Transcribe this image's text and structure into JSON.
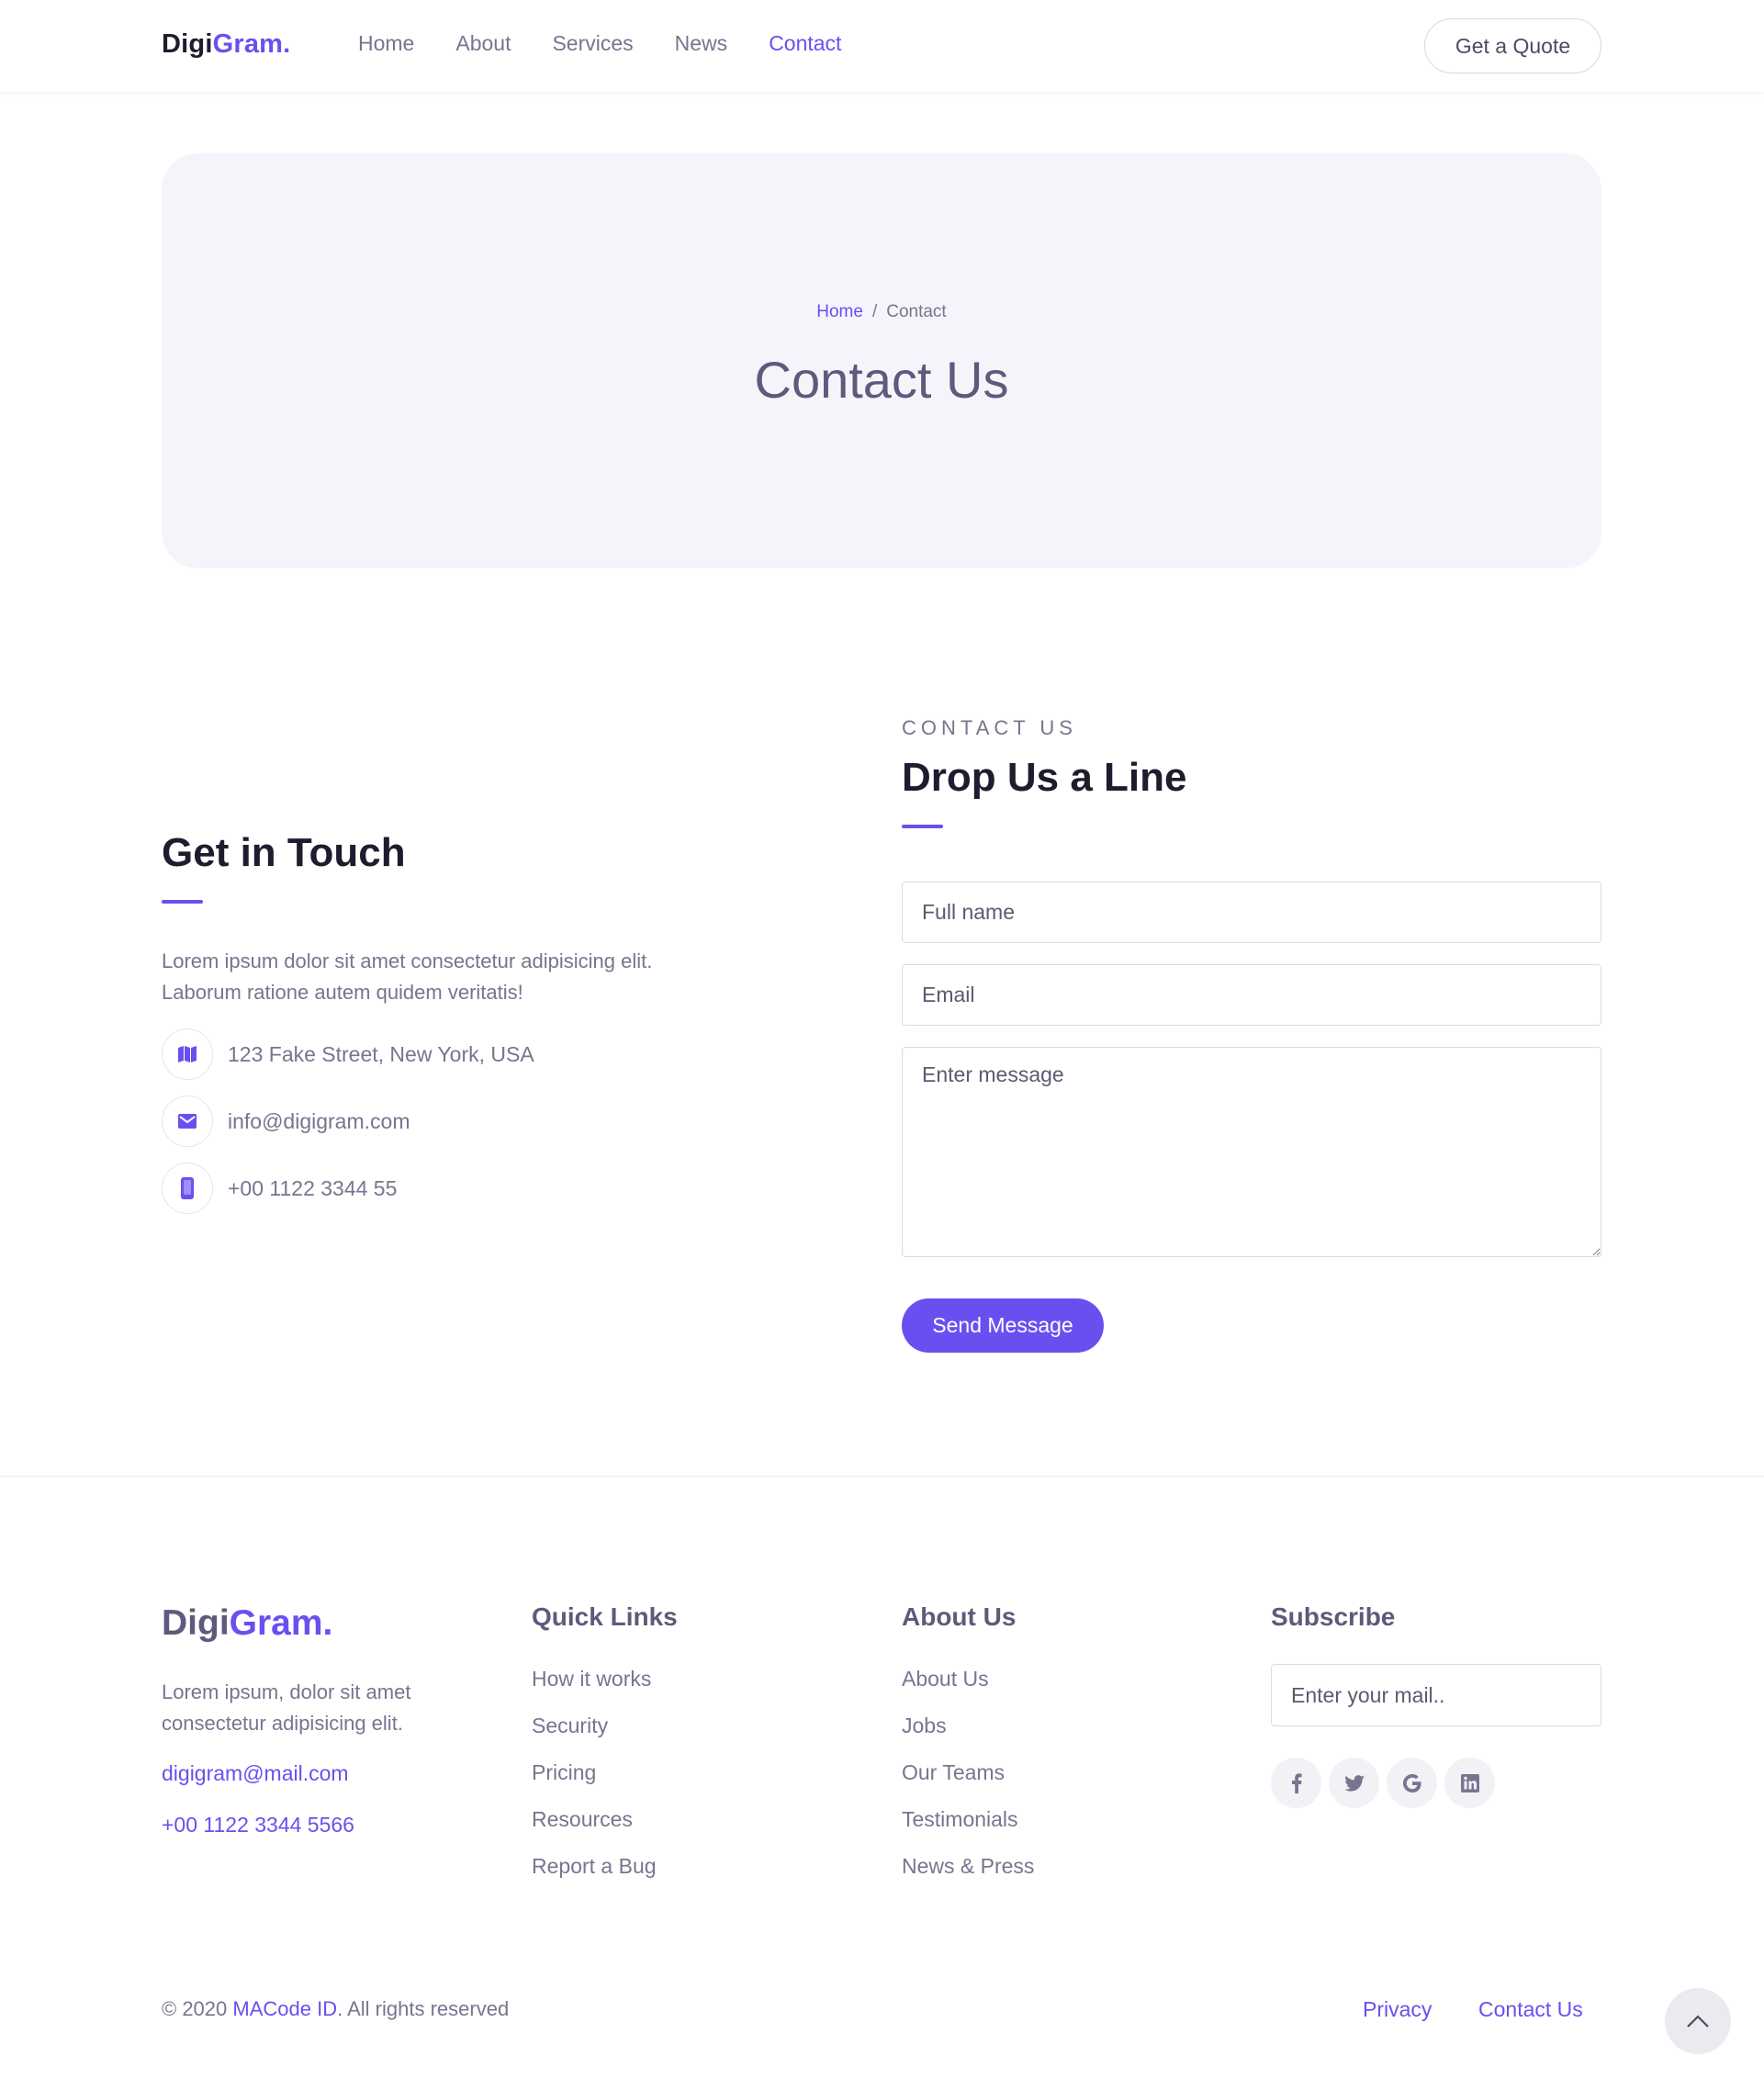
{
  "header": {
    "logo_main": "Digi",
    "logo_accent": "Gram.",
    "nav": [
      "Home",
      "About",
      "Services",
      "News",
      "Contact"
    ],
    "nav_active": "Contact",
    "quote_label": "Get a Quote"
  },
  "hero": {
    "breadcrumb_home": "Home",
    "breadcrumb_sep": "/",
    "breadcrumb_current": "Contact",
    "title": "Contact Us"
  },
  "touch": {
    "title": "Get in Touch",
    "text": "Lorem ipsum dolor sit amet consectetur adipisicing elit. Laborum ratione autem quidem veritatis!",
    "address": "123 Fake Street, New York, USA",
    "email": "info@digigram.com",
    "phone": "+00 1122 3344 55",
    "icons": [
      "map-icon",
      "mail-icon",
      "phone-icon"
    ]
  },
  "form": {
    "eyebrow": "CONTACT US",
    "title": "Drop Us a Line",
    "name_placeholder": "Full name",
    "email_placeholder": "Email",
    "message_placeholder": "Enter message",
    "send_label": "Send Message"
  },
  "footer": {
    "logo_main": "Digi",
    "logo_accent": "Gram.",
    "text": "Lorem ipsum, dolor sit amet consectetur adipisicing elit.",
    "email": "digigram@mail.com",
    "phone": "+00 1122 3344 5566",
    "quick_title": "Quick Links",
    "quick_links": [
      "How it works",
      "Security",
      "Pricing",
      "Resources",
      "Report a Bug"
    ],
    "about_title": "About Us",
    "about_links": [
      "About Us",
      "Jobs",
      "Our Teams",
      "Testimonials",
      "News & Press"
    ],
    "subscribe_title": "Subscribe",
    "subscribe_placeholder": "Enter your mail..",
    "socials": [
      "facebook-icon",
      "twitter-icon",
      "google-icon",
      "linkedin-icon"
    ],
    "copyright_prefix": "© 2020 ",
    "copyright_brand": "MACode ID",
    "copyright_suffix": ". All rights reserved",
    "privacy": "Privacy",
    "contact": "Contact Us"
  },
  "colors": {
    "accent": "#6a4ff0",
    "heading": "#1e1c2e",
    "text": "#77758f",
    "hero_bg": "#f5f4fb"
  }
}
